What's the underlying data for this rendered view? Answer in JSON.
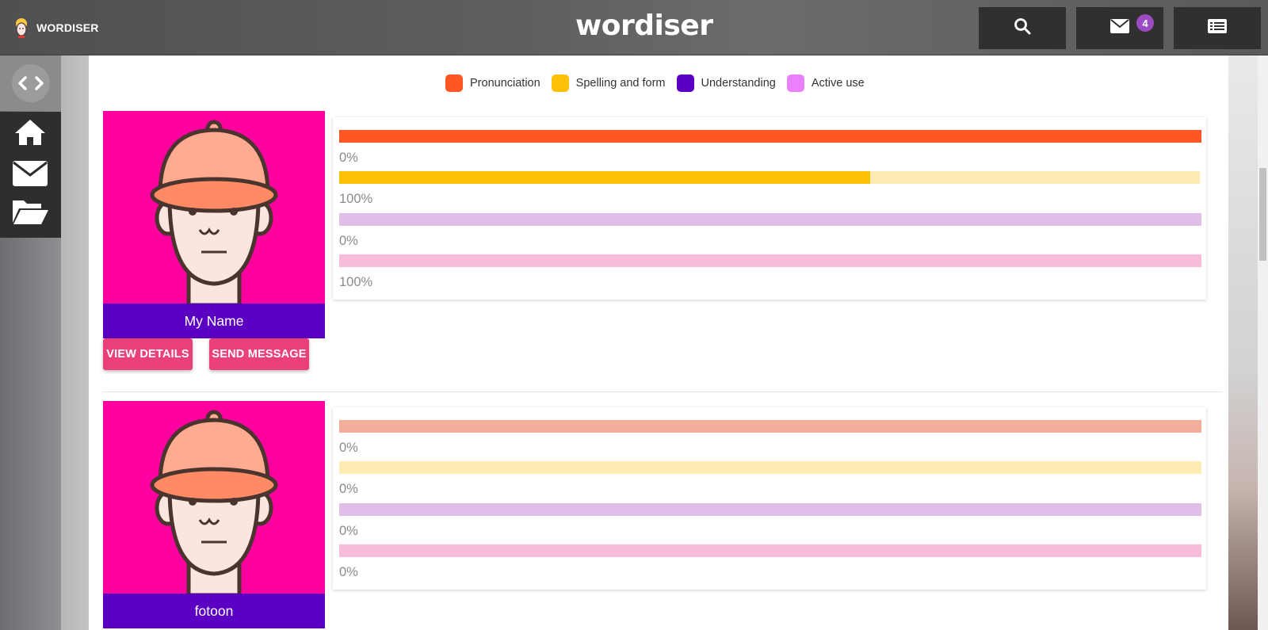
{
  "app": {
    "brand_name": "WORDISER",
    "logo_text": "wordiser",
    "messages_badge": "4"
  },
  "legend": [
    {
      "label": "Pronunciation",
      "color": "#ff5722"
    },
    {
      "label": "Spelling and form",
      "color": "#ffc107"
    },
    {
      "label": "Understanding",
      "color": "#5b00c2"
    },
    {
      "label": "Active use",
      "color": "#ea80fc"
    }
  ],
  "students": [
    {
      "name": "My Name",
      "view_details_label": "VIEW DETAILS",
      "send_message_label": "SEND MESSAGE",
      "bars": [
        {
          "skill": "Pronunciation",
          "label": "0%",
          "fill": 1.0,
          "fill_color": "#ff5722",
          "track_color": "#ff5722"
        },
        {
          "skill": "Spelling and form",
          "label": "100%",
          "fill": 0.617,
          "fill_color": "#ffc107",
          "track_color": "#ffecb3"
        },
        {
          "skill": "Understanding",
          "label": "0%",
          "fill": 0,
          "fill_color": "#5b00c2",
          "track_color": "#e1bee7"
        },
        {
          "skill": "Active use",
          "label": "100%",
          "fill": 0,
          "fill_color": "#ea80fc",
          "track_color": "#f8bbd9"
        }
      ]
    },
    {
      "name": "fotoon",
      "bars": [
        {
          "skill": "Pronunciation",
          "label": "0%",
          "fill": 0,
          "fill_color": "#ff5722",
          "track_color": "#f2ae9a"
        },
        {
          "skill": "Spelling and form",
          "label": "0%",
          "fill": 0,
          "fill_color": "#ffc107",
          "track_color": "#ffecb3"
        },
        {
          "skill": "Understanding",
          "label": "0%",
          "fill": 0,
          "fill_color": "#5b00c2",
          "track_color": "#e1bee7"
        },
        {
          "skill": "Active use",
          "label": "0%",
          "fill": 0,
          "fill_color": "#ea80fc",
          "track_color": "#f8bbd9"
        }
      ]
    }
  ]
}
